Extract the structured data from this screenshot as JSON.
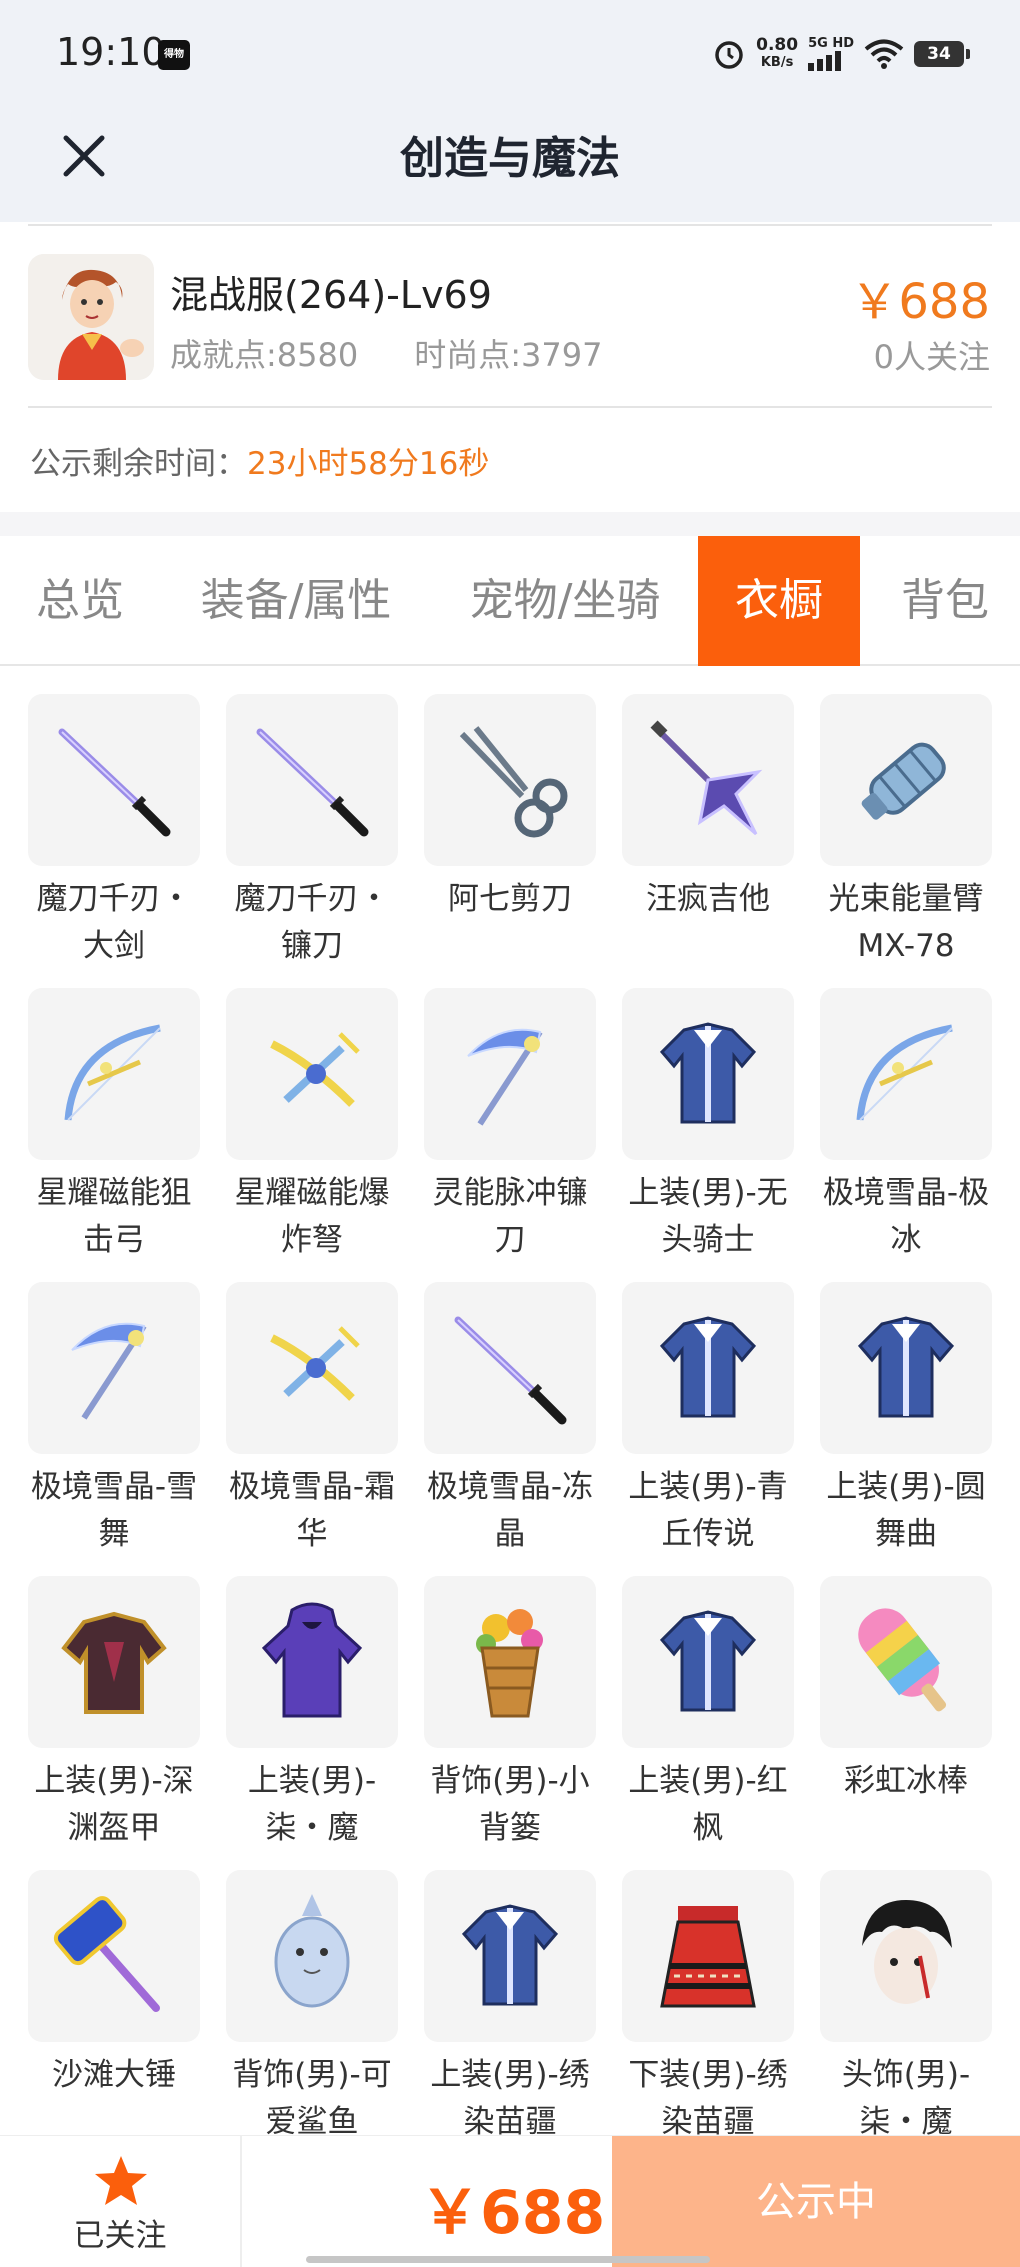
{
  "status_bar": {
    "time": "19:10",
    "badge": "得物",
    "speed_value": "0.80",
    "speed_unit": "KB/s",
    "network": "5G HD",
    "battery": "34"
  },
  "nav": {
    "title": "创造与魔法"
  },
  "account": {
    "name": "混战服(264)-Lv69",
    "achievement": "成就点:8580",
    "fashion": "时尚点:3797",
    "price": "￥688",
    "followers": "0人关注"
  },
  "countdown": {
    "label": "公示剩余时间：",
    "value": "23小时58分16秒"
  },
  "tabs": [
    {
      "label": "总览",
      "active": false
    },
    {
      "label": "装备/属性",
      "active": false
    },
    {
      "label": "宠物/坐骑",
      "active": false
    },
    {
      "label": "衣橱",
      "active": true
    },
    {
      "label": "背包",
      "active": false
    }
  ],
  "items": [
    {
      "label": "魔刀千刃・大剑",
      "icon": "sword-icon"
    },
    {
      "label": "魔刀千刃・镰刀",
      "icon": "sword-icon"
    },
    {
      "label": "阿七剪刀",
      "icon": "scissors-icon"
    },
    {
      "label": "汪疯吉他",
      "icon": "guitar-icon"
    },
    {
      "label": "光束能量臂MX-78",
      "icon": "arm-cannon-icon"
    },
    {
      "label": "星耀磁能狙击弓",
      "icon": "bow-icon"
    },
    {
      "label": "星耀磁能爆炸弩",
      "icon": "crossbow-icon"
    },
    {
      "label": "灵能脉冲镰刀",
      "icon": "scythe-icon"
    },
    {
      "label": "上装(男)-无头骑士",
      "icon": "outfit-icon"
    },
    {
      "label": "极境雪晶-极冰",
      "icon": "bow-icon"
    },
    {
      "label": "极境雪晶-雪舞",
      "icon": "scythe-icon"
    },
    {
      "label": "极境雪晶-霜华",
      "icon": "crossbow-icon"
    },
    {
      "label": "极境雪晶-冻晶",
      "icon": "sword-icon"
    },
    {
      "label": "上装(男)-青丘传说",
      "icon": "outfit-icon"
    },
    {
      "label": "上装(男)-圆舞曲",
      "icon": "outfit-icon"
    },
    {
      "label": "上装(男)-深渊盔甲",
      "icon": "armor-icon"
    },
    {
      "label": "上装(男)-柒・魔",
      "icon": "hoodie-icon"
    },
    {
      "label": "背饰(男)-小背篓",
      "icon": "basket-icon"
    },
    {
      "label": "上装(男)-红枫",
      "icon": "outfit-icon"
    },
    {
      "label": "彩虹冰棒",
      "icon": "popsicle-icon"
    },
    {
      "label": "沙滩大锤",
      "icon": "hammer-icon"
    },
    {
      "label": "背饰(男)-可爱鲨鱼",
      "icon": "shark-icon"
    },
    {
      "label": "上装(男)-绣染苗疆",
      "icon": "outfit-icon"
    },
    {
      "label": "下装(男)-绣染苗疆",
      "icon": "skirt-icon"
    },
    {
      "label": "头饰(男)-柒・魔",
      "icon": "head-icon"
    }
  ],
  "bottom_bar": {
    "follow_label": "已关注",
    "price": "￥688",
    "status_label": "公示中"
  },
  "colors": {
    "accent": "#fb5f0c",
    "price": "#f07a1e",
    "status_button": "#fdb48a"
  }
}
